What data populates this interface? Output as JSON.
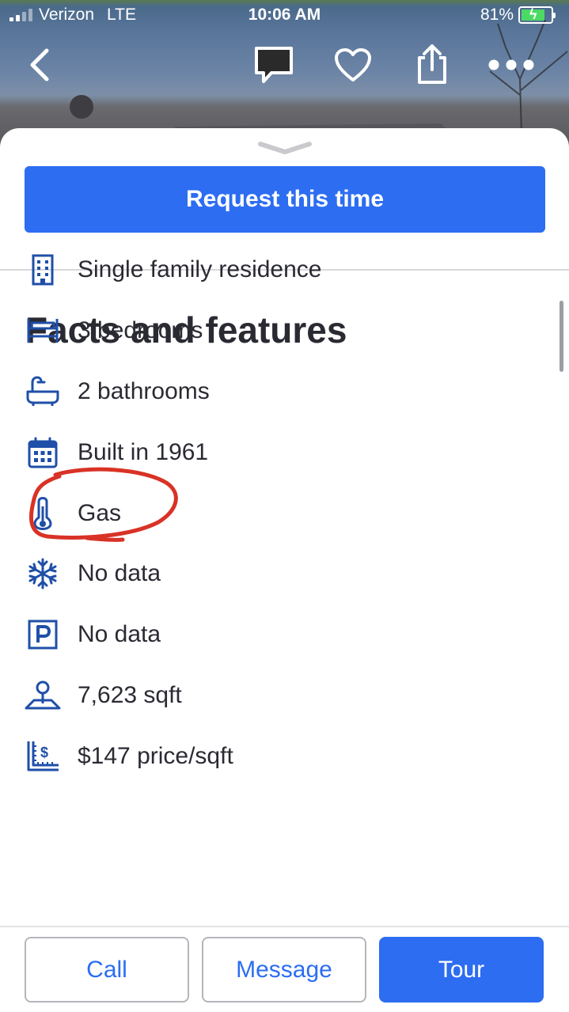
{
  "status_bar": {
    "carrier": "Verizon",
    "network": "LTE",
    "time": "10:06 AM",
    "battery": "81%"
  },
  "top_nav": {
    "icons": [
      "back-chevron-icon",
      "chat-bubble-icon",
      "heart-icon",
      "share-icon",
      "more-dots-icon"
    ]
  },
  "sheet": {
    "request_button": "Request this time",
    "section_title": "Facts and features",
    "facts": [
      {
        "icon": "building-icon",
        "text": "Single family residence"
      },
      {
        "icon": "bed-icon",
        "text": "3 bedrooms"
      },
      {
        "icon": "bathtub-icon",
        "text": "2 bathrooms"
      },
      {
        "icon": "calendar-icon",
        "text": "Built in 1961"
      },
      {
        "icon": "thermometer-icon",
        "text": "Gas"
      },
      {
        "icon": "snowflake-icon",
        "text": "No data"
      },
      {
        "icon": "parking-icon",
        "text": "No data"
      },
      {
        "icon": "lot-size-icon",
        "text": "7,623 sqft"
      },
      {
        "icon": "price-per-sqft-icon",
        "text": "$147 price/sqft"
      }
    ]
  },
  "bottom_bar": {
    "call": "Call",
    "message": "Message",
    "tour": "Tour"
  },
  "colors": {
    "accent": "#2c6df2",
    "icon": "#1f4fa8",
    "annotation": "#d93226"
  }
}
